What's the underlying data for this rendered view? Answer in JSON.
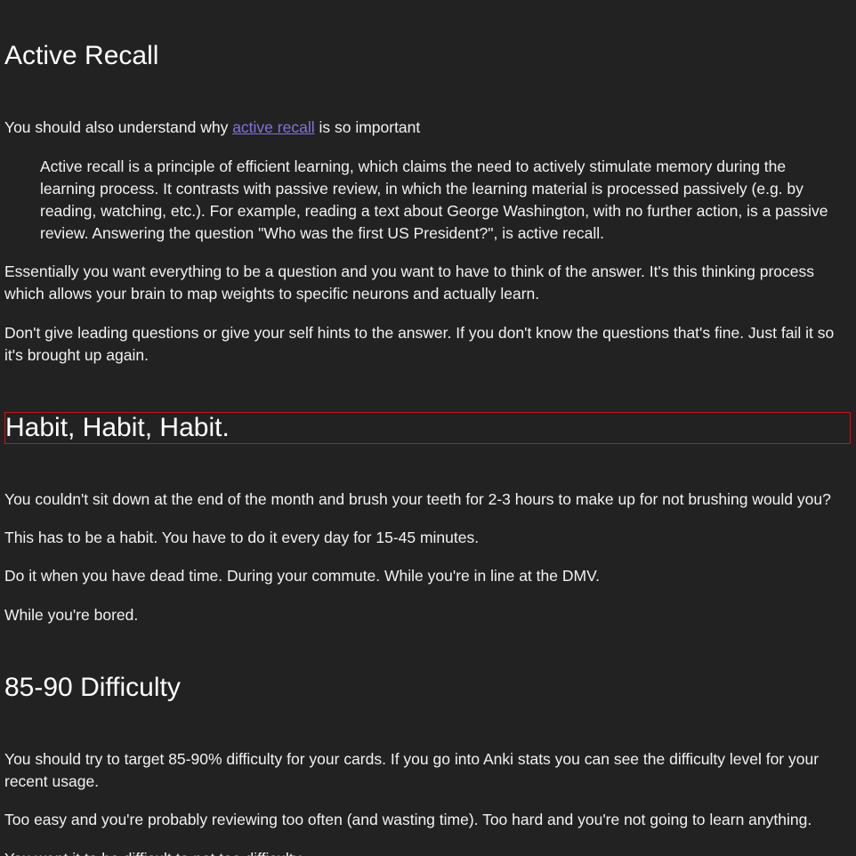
{
  "sections": {
    "active_recall": {
      "heading": "Active Recall",
      "intro_before": "You should also understand why ",
      "intro_link": "active recall",
      "intro_after": " is so important",
      "quote": "Active recall is a principle of efficient learning, which claims the need to actively stimulate memory during the learning process. It contrasts with passive review, in which the learning material is processed passively (e.g. by reading, watching, etc.). For example, reading a text about George Washington, with no further action, is a passive review. Answering the question \"Who was the first US President?\", is active recall.",
      "p1": "Essentially you want everything to be a question and you want to have to think of the answer. It's this thinking process which allows your brain to map weights to specific neurons and actually learn.",
      "p2": "Don't give leading questions or give your self hints to the answer. If you don't know the questions that's fine. Just fail it so it's brought up again."
    },
    "habit": {
      "heading": "Habit, Habit, Habit.",
      "p1": "You couldn't sit down at the end of the month and brush your teeth for 2-3 hours to make up for not brushing would you?",
      "p2": "This has to be a habit. You have to do it every day for 15-45 minutes.",
      "p3": "Do it when you have dead time. During your commute. While you're in line at the DMV.",
      "p4": "While you're bored."
    },
    "difficulty": {
      "heading": "85-90 Difficulty",
      "p1": "You should try to target 85-90% difficulty for your cards. If you go into Anki stats you can see the difficulty level for your recent usage.",
      "p2": "Too easy and you're probably reviewing too often (and wasting time). Too hard and you're not going to learn anything.",
      "p3": "You want it to be difficult to not too difficulty."
    }
  },
  "colors": {
    "background": "#222222",
    "text": "#f2f2f2",
    "link": "#8870e0",
    "highlight_border": "#c0161c"
  }
}
